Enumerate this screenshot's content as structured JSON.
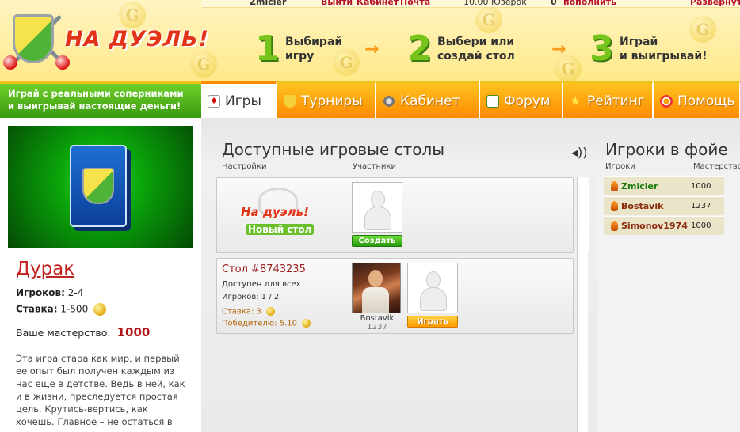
{
  "topbar": {
    "user": "Zmicier",
    "links": [
      "Выйти",
      "Кабинет",
      "Почта"
    ],
    "balance": "10.00 Юзерок",
    "coins": "0",
    "topup": "пополнить",
    "expand": "Развернуть"
  },
  "logo": {
    "title": "НА ДУЭЛЬ!"
  },
  "steps": [
    {
      "num": "1",
      "line1": "Выбирай",
      "line2": "игру"
    },
    {
      "num": "2",
      "line1": "Выбери или",
      "line2": "создай стол"
    },
    {
      "num": "3",
      "line1": "Играй",
      "line2": "и выигрывай!"
    }
  ],
  "promo": {
    "line1": "Играй с реальными соперниками",
    "line2": "и выигрывай настоящие деньги!"
  },
  "nav": {
    "tabs": [
      {
        "label": "Игры",
        "icon": "cards-icon",
        "active": true
      },
      {
        "label": "Турниры",
        "icon": "trophy-icon"
      },
      {
        "label": "Кабинет",
        "icon": "gear-icon"
      },
      {
        "label": "Форум",
        "icon": "forum-icon"
      },
      {
        "label": "Рейтинг",
        "icon": "star-icon"
      },
      {
        "label": "Помощь",
        "icon": "lifebuoy-icon"
      }
    ]
  },
  "game": {
    "title": "Дурак",
    "players_label": "Игроков:",
    "players_value": "2-4",
    "stake_label": "Ставка:",
    "stake_value": "1-500",
    "mastery_label": "Ваше мастерство:",
    "mastery_value": "1000",
    "description": "Эта игра стара как мир, и первый ее опыт был получен каждым из нас еще в детстве. Ведь в ней, как и в жизни, преследуется простая цель. Крутись-вертись, как хочешь. Главное – не остаться в дураках."
  },
  "tables": {
    "title": "Доступные игровые столы",
    "col_settings": "Настройки",
    "col_participants": "Участники",
    "new_table": {
      "line1": "На дуэль!",
      "line2": "Новый стол",
      "create_label": "Создать"
    },
    "table1": {
      "title": "Стол #8743235",
      "access": "Доступен для всех",
      "players": "Игроков: 1 / 2",
      "stake": "Ставка: 3",
      "prize": "Победителю: 5.10",
      "player_name": "Bostavik",
      "player_rating": "1237",
      "play_label": "Играть"
    }
  },
  "lobby": {
    "title": "Игроки в фойе",
    "col_players": "Игроки",
    "col_mastery": "Мастерство",
    "players": [
      {
        "name": "Zmicier",
        "rating": "1000",
        "color": "#1a7a0c"
      },
      {
        "name": "Bostavik",
        "rating": "1237",
        "color": "#8a2a0c"
      },
      {
        "name": "Simonov1974",
        "rating": "1000",
        "color": "#8a2a0c"
      }
    ]
  }
}
